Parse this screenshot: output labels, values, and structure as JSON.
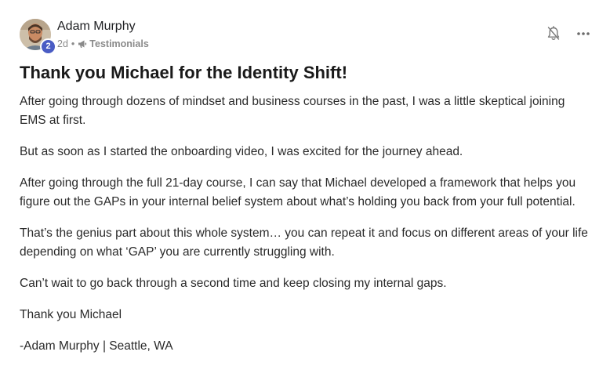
{
  "post": {
    "author": {
      "name": "Adam Murphy",
      "level": "2"
    },
    "meta": {
      "time": "2d",
      "separator": "•",
      "category": "Testimonials"
    },
    "title": "Thank you Michael for the Identity Shift!",
    "paragraphs": [
      "After going through dozens of mindset and business courses in the past, I was a little skeptical joining EMS at first.",
      "But as soon as I started the onboarding video, I was excited for the journey ahead.",
      "After going through the full 21-day course, I can say that Michael developed a framework that helps you figure out the GAPs in your internal belief system about what’s holding you back from your full potential.",
      "That’s the genius part about this whole system… you can repeat it and focus on different areas of your life depending on what ‘GAP’ you are currently struggling with.",
      "Can’t wait to go back through a second time and keep closing my internal gaps.",
      "Thank you Michael",
      "-Adam Murphy | Seattle, WA"
    ],
    "icons": {
      "notification": "bell-off-icon",
      "more": "more-horizontal-icon",
      "category": "megaphone-icon"
    }
  },
  "colors": {
    "level_badge": "#4a5cc4",
    "meta_text": "#8a8a8a",
    "title_text": "#1a1a1a"
  }
}
